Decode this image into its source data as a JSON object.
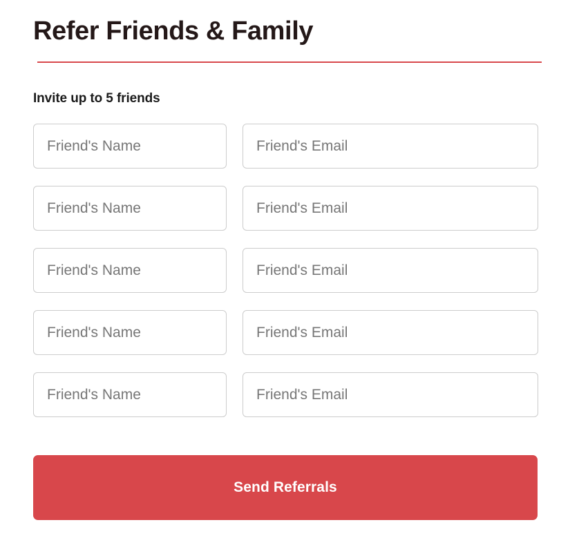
{
  "theme": {
    "accent_red": "#d8474b",
    "title_color": "#241818",
    "label_color": "#1a1a1a",
    "field_border": "#cccccc",
    "placeholder_color": "#767676",
    "page_background": "#ffffff",
    "button_text_color": "#ffffff"
  },
  "header": {
    "title": "Refer Friends & Family",
    "rule_color": "#d8474b"
  },
  "form": {
    "section_label": "Invite up to 5 friends",
    "max_invites": 5,
    "rows": [
      {
        "name_value": "",
        "name_placeholder": "Friend's Name",
        "email_value": "",
        "email_placeholder": "Friend's Email"
      },
      {
        "name_value": "",
        "name_placeholder": "Friend's Name",
        "email_value": "",
        "email_placeholder": "Friend's Email"
      },
      {
        "name_value": "",
        "name_placeholder": "Friend's Name",
        "email_value": "",
        "email_placeholder": "Friend's Email"
      },
      {
        "name_value": "",
        "name_placeholder": "Friend's Name",
        "email_value": "",
        "email_placeholder": "Friend's Email"
      },
      {
        "name_value": "",
        "name_placeholder": "Friend's Name",
        "email_value": "",
        "email_placeholder": "Friend's Email"
      }
    ],
    "submit_label": "Send Referrals"
  }
}
